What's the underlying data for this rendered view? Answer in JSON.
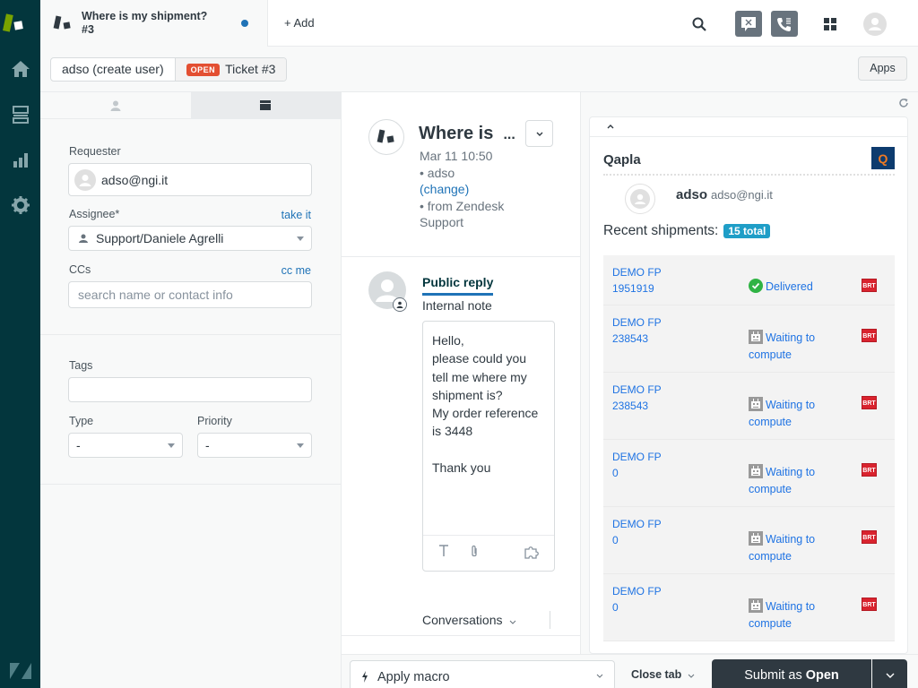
{
  "nav": {
    "items": [
      {
        "name": "home",
        "icon": "home-icon"
      },
      {
        "name": "views",
        "icon": "views-icon"
      },
      {
        "name": "reporting",
        "icon": "reporting-icon"
      },
      {
        "name": "admin",
        "icon": "gear-icon"
      }
    ]
  },
  "header": {
    "tab_title": "Where is my shipment?",
    "tab_subtitle": "#3",
    "add_label": "+ Add",
    "icons": [
      "search-icon",
      "chat-icon",
      "talk-icon",
      "products-icon",
      "user-avatar-icon"
    ]
  },
  "breadcrumb": {
    "requester": "adso (create user)",
    "status_badge": "OPEN",
    "ticket": "Ticket #3"
  },
  "apps_button": "Apps",
  "properties": {
    "requester_label": "Requester",
    "requester_value": "adso@ngi.it",
    "assignee_label": "Assignee*",
    "take_it": "take it",
    "assignee_value": "Support/Daniele Agrelli",
    "ccs_label": "CCs",
    "cc_me": "cc me",
    "ccs_placeholder": "search name or contact info",
    "tags_label": "Tags",
    "tags_value": "",
    "type_label": "Type",
    "type_value": "-",
    "priority_label": "Priority",
    "priority_value": "-"
  },
  "conversation": {
    "subject": "Where is",
    "subject_ellipsis": "...",
    "date": "Mar 11 10:50",
    "author": "• adso",
    "change_link": "(change)",
    "source": "• from Zendesk Support",
    "reply_tabs": [
      "Public reply",
      "Internal note"
    ],
    "editor_text": "Hello,\nplease could you tell me where my shipment is?\nMy order reference is 3448\n\nThank you",
    "filter_label": "Conversations"
  },
  "app": {
    "name": "Qapla",
    "logo_letter": "Q",
    "customer_name": "adso",
    "customer_email": "adso@ngi.it",
    "recent_label": "Recent shipments:",
    "total_badge": "15 total",
    "shipments": [
      {
        "line1": "DEMO FP",
        "line2": "1951919",
        "status": "Delivered",
        "status_type": "delivered",
        "carrier": "BRT"
      },
      {
        "line1": "DEMO FP",
        "line2": "238543",
        "status": "Waiting to compute",
        "status_type": "waiting",
        "carrier": "BRT"
      },
      {
        "line1": "DEMO FP",
        "line2": "238543",
        "status": "Waiting to compute",
        "status_type": "waiting",
        "carrier": "BRT"
      },
      {
        "line1": "DEMO FP",
        "line2": "0",
        "status": "Waiting to compute",
        "status_type": "waiting",
        "carrier": "BRT"
      },
      {
        "line1": "DEMO FP",
        "line2": "0",
        "status": "Waiting to compute",
        "status_type": "waiting",
        "carrier": "BRT"
      },
      {
        "line1": "DEMO FP",
        "line2": "0",
        "status": "Waiting to compute",
        "status_type": "waiting",
        "carrier": "BRT"
      }
    ]
  },
  "footer": {
    "macro_label": "Apply macro",
    "close_tab": "Close tab",
    "submit_prefix": "Submit as ",
    "submit_status": "Open"
  },
  "colors": {
    "nav_bg": "#03363d",
    "accent_blue": "#1f73b7",
    "open_badge": "#e34f32",
    "total_badge": "#1f9ec7",
    "delivered_green": "#2fb344",
    "brt_red": "#d9232e",
    "submit_bg": "#2f3941"
  }
}
